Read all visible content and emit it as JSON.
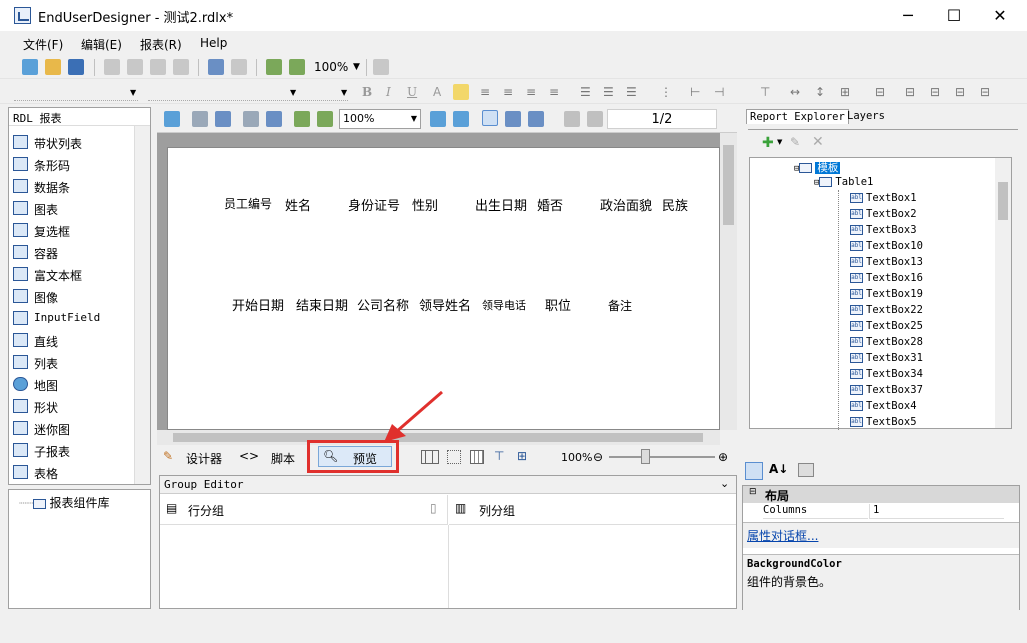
{
  "window": {
    "title": "EndUserDesigner - 测试2.rdlx*",
    "min": "─",
    "max": "☐",
    "close": "✕"
  },
  "menu": [
    "文件(F)",
    "编辑(E)",
    "报表(R)",
    "Help"
  ],
  "toolbar": {
    "zoom": "100%"
  },
  "toolbox": {
    "header": "RDL 报表",
    "items": [
      "带状列表",
      "条形码",
      "数据条",
      "图表",
      "复选框",
      "容器",
      "富文本框",
      "图像",
      "InputField",
      "直线",
      "列表",
      "地图",
      "形状",
      "迷你图",
      "子报表",
      "表格"
    ]
  },
  "component_library": {
    "label": "报表组件库"
  },
  "designer": {
    "zoom": "100%",
    "page": "1/2",
    "row1": [
      "员工编号",
      "姓名",
      "身份证号",
      "性别",
      "出生日期",
      "婚否",
      "政治面貌",
      "民族"
    ],
    "row2": [
      "开始日期",
      "结束日期",
      "公司名称",
      "领导姓名",
      "领导电话",
      "职位",
      "备注"
    ]
  },
  "view_tabs": {
    "designer": "设计器",
    "script": "脚本",
    "preview": "预览",
    "zoom": "100%"
  },
  "group_editor": {
    "title": "Group Editor",
    "row_group": "行分组",
    "col_group": "列分组"
  },
  "report_explorer": {
    "tab1": "Report Explorer",
    "tab2": "Layers",
    "root": "模板",
    "table": "Table1",
    "items": [
      "TextBox1",
      "TextBox2",
      "TextBox3",
      "TextBox10",
      "TextBox13",
      "TextBox16",
      "TextBox19",
      "TextBox22",
      "TextBox25",
      "TextBox28",
      "TextBox31",
      "TextBox34",
      "TextBox37",
      "TextBox4",
      "TextBox5"
    ]
  },
  "properties": {
    "category": "布局",
    "name": "Columns",
    "value": "1",
    "link": "属性对话框...",
    "desc_title": "BackgroundColor",
    "desc_text": "组件的背景色。"
  },
  "colors": {
    "accent": "#2b5797",
    "highlight": "#e0302d"
  }
}
